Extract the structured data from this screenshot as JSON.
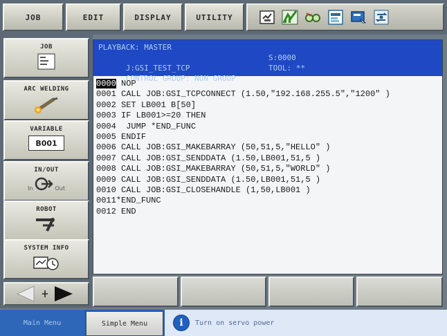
{
  "topbar": {
    "tabs": [
      "JOB",
      "EDIT",
      "DISPLAY",
      "UTILITY"
    ],
    "status_icons": [
      "manual-mode-icon",
      "signal-icon",
      "glasses-icon",
      "teach-icon",
      "screen-icon",
      "cycle-icon"
    ]
  },
  "left_menu": [
    {
      "label": "JOB",
      "icon": "job-sheet-icon"
    },
    {
      "label": "ARC WELDING",
      "icon": "welding-torch-icon"
    },
    {
      "label": "VARIABLE",
      "icon": "variable-box-icon",
      "value": "B001"
    },
    {
      "label": "IN/OUT",
      "icon": "in-out-icon",
      "sub_in": "In",
      "sub_out": "Out"
    },
    {
      "label": "ROBOT",
      "icon": "robot-arm-icon"
    },
    {
      "label": "SYSTEM INFO",
      "icon": "system-info-icon"
    }
  ],
  "header": {
    "line1": "PLAYBACK: MASTER",
    "job": "J:GSI_TEST_TCP",
    "step": "S:0000",
    "control_group": "CONTROL GROUP: NON GROUP",
    "tool": "TOOL: **"
  },
  "program": [
    {
      "num": "0000",
      "code": " NOP"
    },
    {
      "num": "0001",
      "code": " CALL JOB:GSI_TCPCONNECT (1.50,\"192.168.255.5\",\"1200\" )"
    },
    {
      "num": "0002",
      "code": " SET LB001 B[50]"
    },
    {
      "num": "0003",
      "code": " IF LB001>=20 THEN"
    },
    {
      "num": "0004",
      "code": "  JUMP *END_FUNC"
    },
    {
      "num": "0005",
      "code": " ENDIF"
    },
    {
      "num": "0006",
      "code": " CALL JOB:GSI_MAKEBARRAY (50,51,5,\"HELLO\" )"
    },
    {
      "num": "0007",
      "code": " CALL JOB:GSI_SENDDATA (1.50,LB001,51,5 )"
    },
    {
      "num": "0008",
      "code": " CALL JOB:GSI_MAKEBARRAY (50,51,5,\"WORLD\" )"
    },
    {
      "num": "0009",
      "code": " CALL JOB:GSI_SENDDATA (1.50,LB001,51,5 )"
    },
    {
      "num": "0010",
      "code": " CALL JOB:GSI_CLOSEHANDLE (1,50,LB001 )"
    },
    {
      "num": "0011",
      "code": "*END_FUNC"
    },
    {
      "num": "0012",
      "code": " END"
    }
  ],
  "statusbar": {
    "main_menu": "Main Menu",
    "simple_menu": "Simple Menu",
    "message": "Turn on servo power"
  },
  "colors": {
    "header_bg": "#1f48c4",
    "header_text": "#aecdf3",
    "status_blue": "#2a5fb0"
  }
}
